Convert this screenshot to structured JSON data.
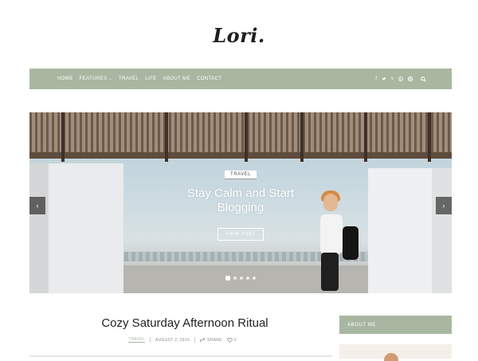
{
  "site": {
    "logo": "Lori."
  },
  "nav": {
    "items": [
      {
        "label": "HOME",
        "has_dropdown": false
      },
      {
        "label": "FEATURES",
        "has_dropdown": true
      },
      {
        "label": "TRAVEL",
        "has_dropdown": false
      },
      {
        "label": "LIFE",
        "has_dropdown": false
      },
      {
        "label": "ABOUT ME",
        "has_dropdown": false
      },
      {
        "label": "CONTACT",
        "has_dropdown": false
      }
    ],
    "social_icons": [
      "facebook-icon",
      "twitter-icon",
      "vimeo-icon",
      "pinterest-icon",
      "instagram-icon"
    ],
    "search_icon": "search-icon",
    "background_color": "#a9b7a1"
  },
  "slider": {
    "category": "TRAVEL",
    "title_line1": "Stay Calm and Start",
    "title_line2": "Blogging",
    "button_label": "VIEW POST",
    "prev_arrow": "‹",
    "next_arrow": "›",
    "active_dot": 1,
    "dot_count": 5
  },
  "post": {
    "title": "Cozy Saturday Afternoon Ritual",
    "category": "TRAVEL",
    "date": "AUGUST 2, 2016",
    "share_label": "SHARE",
    "likes": "2"
  },
  "sidebar": {
    "widget_title": "ABOUT ME",
    "accent_color": "#a9b7a1"
  }
}
